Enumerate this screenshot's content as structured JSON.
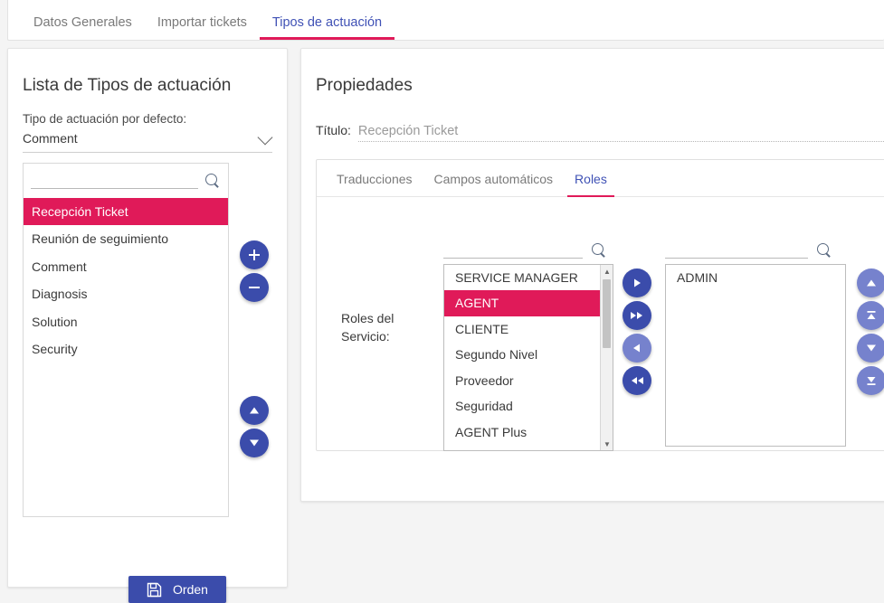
{
  "top_tabs": [
    {
      "label": "Datos Generales",
      "active": false
    },
    {
      "label": "Importar tickets",
      "active": false
    },
    {
      "label": "Tipos de actuación",
      "active": true
    }
  ],
  "left_panel": {
    "title": "Lista de Tipos de actuación",
    "default_label": "Tipo de actuación por defecto:",
    "default_value": "Comment",
    "search_placeholder": "",
    "search_value": "",
    "search_icon": "search-icon",
    "items": [
      {
        "label": "Recepción Ticket",
        "selected": true
      },
      {
        "label": "Reunión de seguimiento",
        "selected": false
      },
      {
        "label": "Comment",
        "selected": false
      },
      {
        "label": "Diagnosis",
        "selected": false
      },
      {
        "label": "Solution",
        "selected": false
      },
      {
        "label": "Security",
        "selected": false
      }
    ],
    "buttons": [
      {
        "name": "add-type-button",
        "icon": "plus-icon",
        "enabled": true
      },
      {
        "name": "remove-type-button",
        "icon": "minus-icon",
        "enabled": true
      },
      {
        "name": "move-up-button",
        "icon": "triangle-up-icon",
        "enabled": true
      },
      {
        "name": "move-down-button",
        "icon": "triangle-down-icon",
        "enabled": true
      }
    ],
    "order_button": {
      "label": "Orden",
      "icon": "save-floppy-icon"
    }
  },
  "right_panel": {
    "title": "Propiedades",
    "titulo_label": "Título:",
    "titulo_value": "Recepción Ticket",
    "tabs": [
      {
        "label": "Traducciones",
        "active": false
      },
      {
        "label": "Campos automáticos",
        "active": false
      },
      {
        "label": "Roles",
        "active": true
      }
    ],
    "roles_label": "Roles del Servicio:",
    "available": {
      "search_value": "",
      "search_icon": "search-icon",
      "items": [
        {
          "label": "SERVICE MANAGER",
          "selected": false
        },
        {
          "label": "AGENT",
          "selected": true
        },
        {
          "label": "CLIENTE",
          "selected": false
        },
        {
          "label": "Segundo Nivel",
          "selected": false
        },
        {
          "label": "Proveedor",
          "selected": false
        },
        {
          "label": "Seguridad",
          "selected": false
        },
        {
          "label": "AGENT Plus",
          "selected": false
        }
      ]
    },
    "assigned": {
      "search_value": "",
      "search_icon": "search-icon",
      "items": [
        {
          "label": "ADMIN",
          "selected": false
        }
      ]
    },
    "transfer_buttons": [
      {
        "name": "move-right-button",
        "icon": "play-right-icon",
        "enabled": true
      },
      {
        "name": "move-all-right-button",
        "icon": "fast-forward-icon",
        "enabled": true
      },
      {
        "name": "move-left-button",
        "icon": "play-left-icon",
        "enabled": false
      },
      {
        "name": "move-all-left-button",
        "icon": "fast-rewind-icon",
        "enabled": true
      }
    ],
    "order_buttons": [
      {
        "name": "assigned-move-up-button",
        "icon": "triangle-up-icon",
        "enabled": false
      },
      {
        "name": "assigned-move-top-button",
        "icon": "triangle-up-bar-icon",
        "enabled": false
      },
      {
        "name": "assigned-move-down-button",
        "icon": "triangle-down-icon",
        "enabled": false
      },
      {
        "name": "assigned-move-bottom-button",
        "icon": "triangle-down-bar-icon",
        "enabled": false
      }
    ]
  },
  "colors": {
    "accent_pink": "#e01a59",
    "accent_blue": "#3b4cab",
    "tab_blue": "#3f51b5",
    "page_bg": "#f4f4f4"
  }
}
